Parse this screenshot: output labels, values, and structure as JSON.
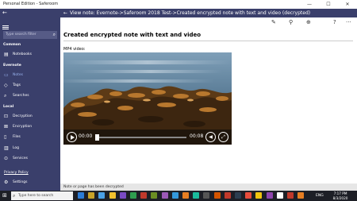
{
  "window": {
    "title": "Personal Edition - Saferoom",
    "min_glyph": "—",
    "max_glyph": "☐",
    "close_glyph": "✕"
  },
  "sidebar": {
    "back_glyph": "←",
    "search_placeholder": "Type search filter",
    "sections": {
      "common": "Common",
      "evernote": "Evernote",
      "local": "Local"
    },
    "items": [
      {
        "label": "Notebooks",
        "icon": "notebook-icon",
        "glyph": "▤"
      },
      {
        "label": "Notes",
        "icon": "note-icon",
        "glyph": "▭",
        "active": true
      },
      {
        "label": "Tags",
        "icon": "tag-icon",
        "glyph": "◇"
      },
      {
        "label": "Searches",
        "icon": "search-icon",
        "glyph": "⌕"
      },
      {
        "label": "Decryption",
        "icon": "unlock-icon",
        "glyph": "⊡"
      },
      {
        "label": "Encryption",
        "icon": "lock-icon",
        "glyph": "⊠"
      },
      {
        "label": "Files",
        "icon": "file-icon",
        "glyph": "▯"
      },
      {
        "label": "Log",
        "icon": "log-icon",
        "glyph": "▥"
      },
      {
        "label": "Services",
        "icon": "services-icon",
        "glyph": "⊙"
      }
    ],
    "privacy_policy": "Privacy Policy",
    "settings": {
      "label": "Settings",
      "icon": "gear-icon",
      "glyph": "⚙"
    }
  },
  "header": {
    "back_glyph": "←",
    "title": "View note: Evernote->Saferoom 2018 Test->Created encrypted note with text and video (decrypted)"
  },
  "toolbar": {
    "icons": [
      {
        "name": "edit-icon",
        "glyph": "✎"
      },
      {
        "name": "pin-icon",
        "glyph": "⚲"
      },
      {
        "name": "globe-icon",
        "glyph": "⊕"
      },
      {
        "name": "help-icon",
        "glyph": "?"
      },
      {
        "name": "more-icon",
        "glyph": "···"
      }
    ]
  },
  "note": {
    "title": "Created encrypted note with text and video",
    "mp4_label": "MP4 video:"
  },
  "video": {
    "current_time": "00:00",
    "duration": "00:08",
    "progress": 0,
    "volume_glyph": "◀",
    "fullscreen_glyph": "⤢"
  },
  "status": {
    "text": "Note or page has been decrypted"
  },
  "taskbar": {
    "search_placeholder": "Type here to search",
    "start_glyph": "⊞",
    "tray_text": "ENG",
    "time": "7:17 PM",
    "date": "8/3/2020",
    "app_colors": [
      "#2b7bd6",
      "#c9a227",
      "#4aa0e6",
      "#f2c12e",
      "#7a4bc4",
      "#2e9e4f",
      "#c0392b",
      "#6b8e23",
      "#9b59b6",
      "#3498db",
      "#e67e22",
      "#1abc9c",
      "#555555",
      "#d35400",
      "#c0392b",
      "#2c3e50",
      "#e74c3c",
      "#f1c40f",
      "#8e44ad",
      "#ffffff",
      "#c0392b",
      "#e67e22"
    ]
  },
  "colors": {
    "sidebar_bg": "#3a3f6b",
    "active_item": "#9ab4f0",
    "status_bg": "#e6e6e6"
  }
}
